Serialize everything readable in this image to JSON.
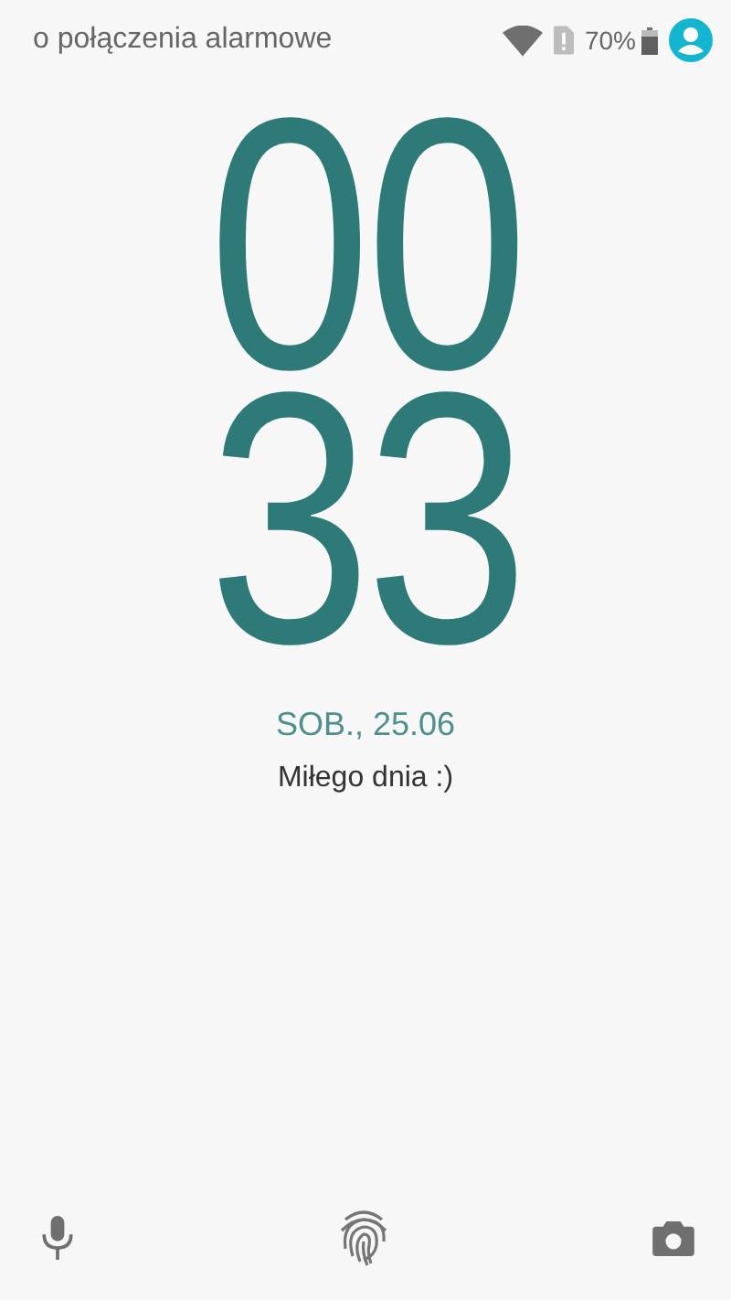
{
  "status_bar": {
    "carrier_text": "o połączenia alarmowe",
    "battery_percent": "70%"
  },
  "clock": {
    "hours": "00",
    "minutes": "33"
  },
  "date": "SOB., 25.06",
  "message": "Miłego dnia :)"
}
